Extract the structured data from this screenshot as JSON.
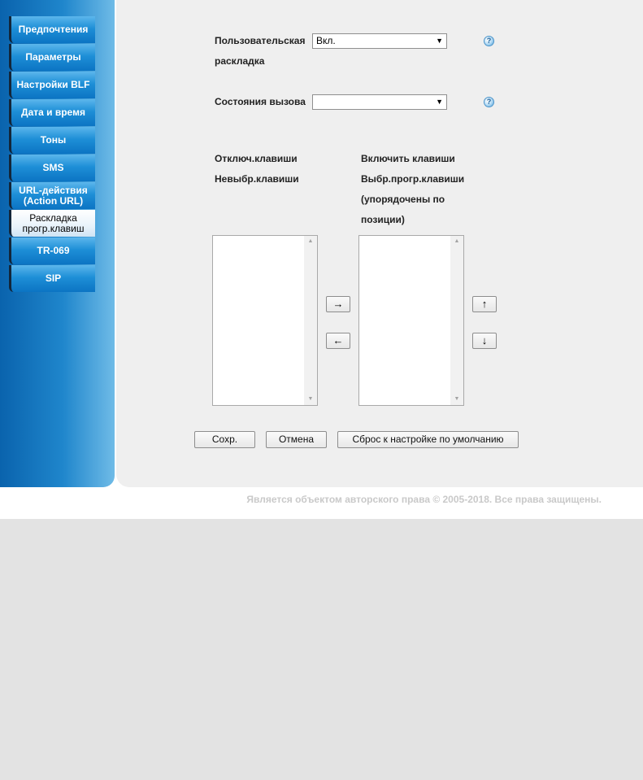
{
  "sidebar": {
    "items": [
      {
        "label": "Предпочтения"
      },
      {
        "label": "Параметры"
      },
      {
        "label": "Настройки BLF"
      },
      {
        "label": "Дата и время"
      },
      {
        "label": "Тоны"
      },
      {
        "label": "SMS"
      },
      {
        "label": "URL-действия (Action URL)"
      },
      {
        "label": "Раскладка прогр.клавиш"
      },
      {
        "label": "TR-069"
      },
      {
        "label": "SIP"
      }
    ]
  },
  "form": {
    "custom_layout": {
      "label_line1": "Пользовательская",
      "label_line2": "раскладка",
      "value": "Вкл."
    },
    "call_state": {
      "label": "Состояния вызова",
      "value": ""
    },
    "help_glyph": "?"
  },
  "keys": {
    "left_header_line1": "Отключ.клавиши",
    "left_header_line2": "Невыбр.клавиши",
    "right_header_line1": "Включить клавиши",
    "right_header_line2": "Выбр.прогр.клавиши",
    "right_header_line3": "(упорядочены по",
    "right_header_line4": "позиции)",
    "move_right": "→",
    "move_left": "←",
    "move_up": "↑",
    "move_down": "↓"
  },
  "buttons": {
    "save": "Сохр.",
    "cancel": "Отмена",
    "reset": "Сброс к настройке по умолчанию"
  },
  "footer": {
    "copyright": "Является объектом авторского права © 2005-2018. Все права защищены."
  },
  "colors": {
    "sidebar": "#1f86cc",
    "content_bg": "#efefef",
    "page_bg": "#e3e3e3"
  }
}
